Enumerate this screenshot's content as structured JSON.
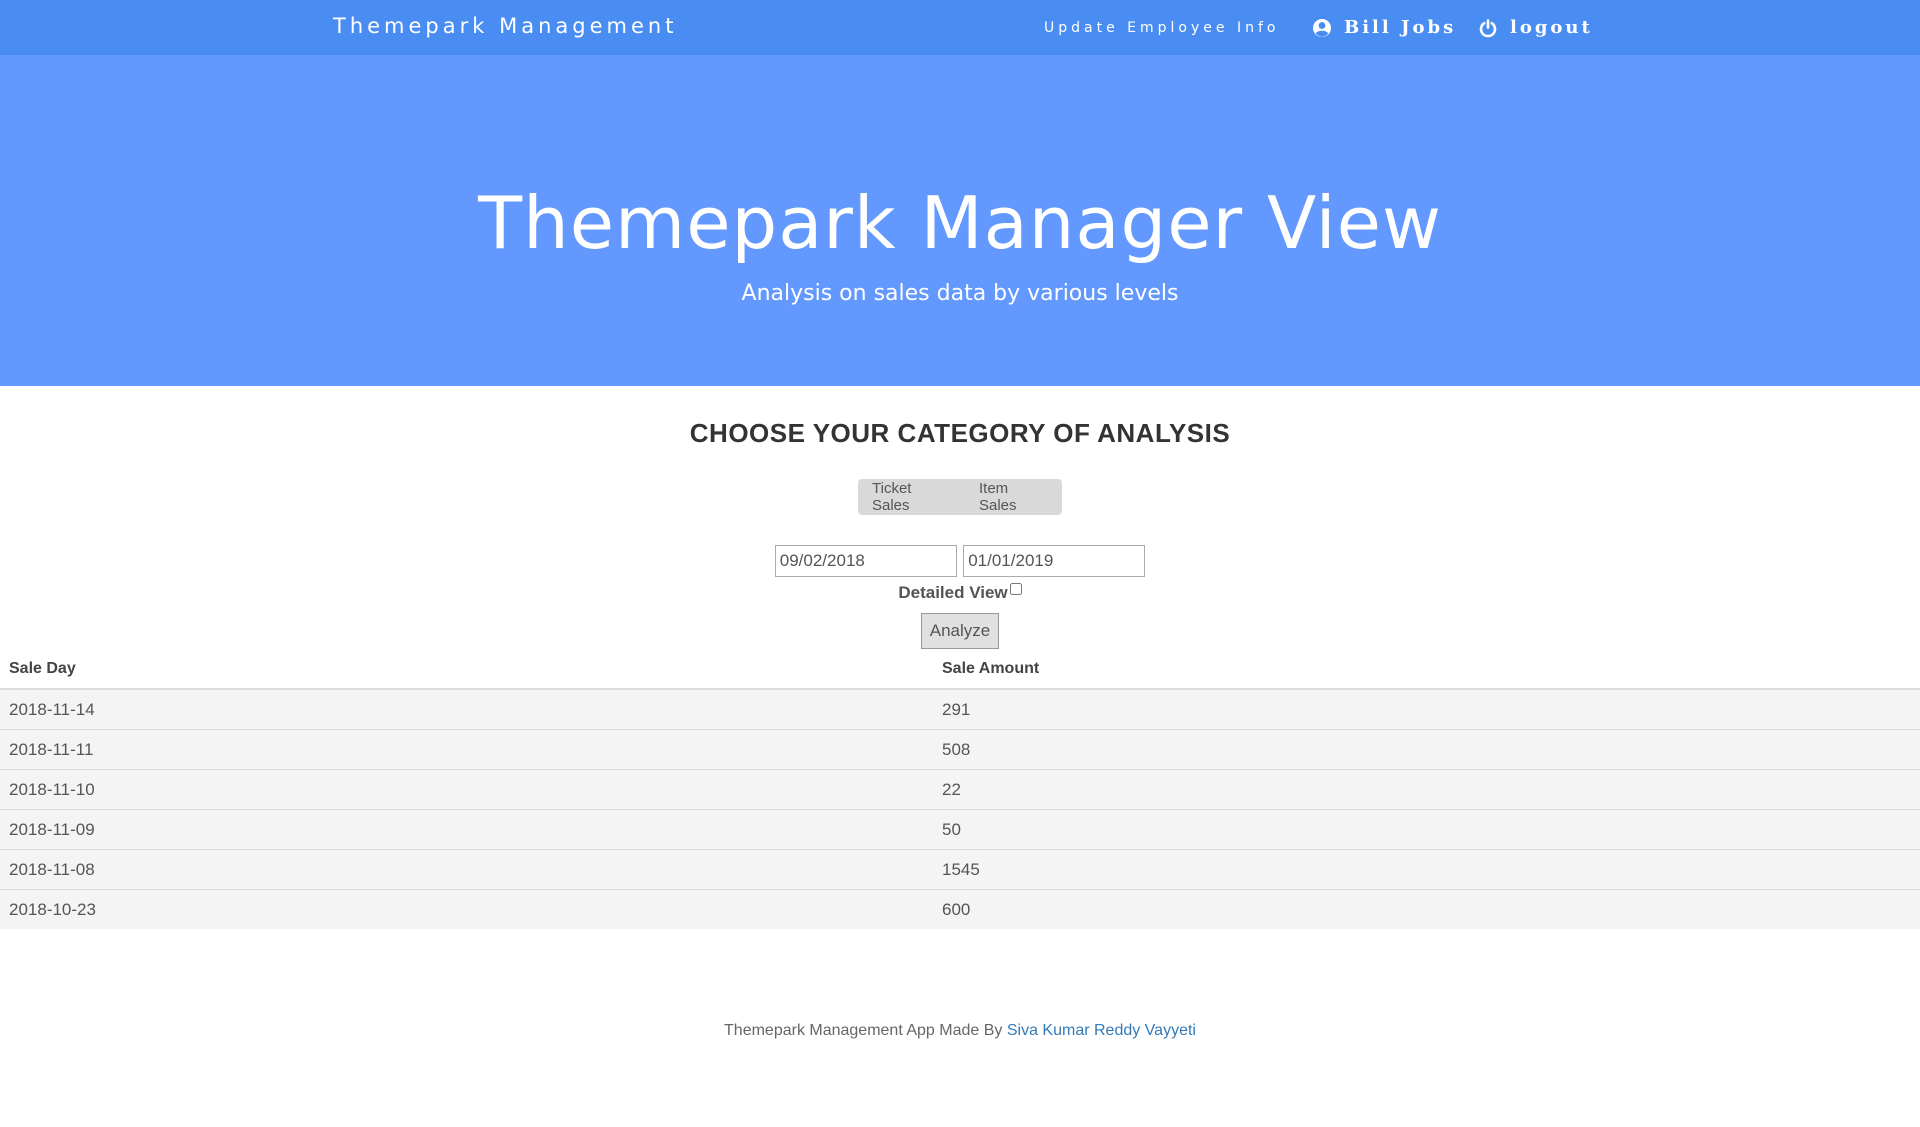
{
  "navbar": {
    "brand": "Themepark Management",
    "update_label": "Update Employee Info",
    "user_label": "Bill Jobs",
    "logout_label": "logout"
  },
  "hero": {
    "title": "Themepark Manager View",
    "subtitle": "Analysis on sales data by various levels"
  },
  "analysis": {
    "heading": "CHOOSE YOUR CATEGORY OF ANALYSIS",
    "tabs": [
      "Ticket Sales",
      "Item Sales"
    ],
    "start_date": "09/02/2018",
    "end_date": "01/01/2019",
    "detailed_label": "Detailed View",
    "analyze_label": "Analyze"
  },
  "table": {
    "headers": [
      "Sale Day",
      "Sale Amount"
    ],
    "rows": [
      [
        "2018-11-14",
        "291"
      ],
      [
        "2018-11-11",
        "508"
      ],
      [
        "2018-11-10",
        "22"
      ],
      [
        "2018-11-09",
        "50"
      ],
      [
        "2018-11-08",
        "1545"
      ],
      [
        "2018-10-23",
        "600"
      ]
    ]
  },
  "footer": {
    "text": "Themepark Management App Made By ",
    "author": "Siva Kumar Reddy Vayyeti"
  },
  "colors": {
    "navbar": "#4a8df2",
    "hero": "#6398ff",
    "link": "#337ab7"
  },
  "icons": {
    "user": "user-circle-icon",
    "logout": "power-icon"
  }
}
